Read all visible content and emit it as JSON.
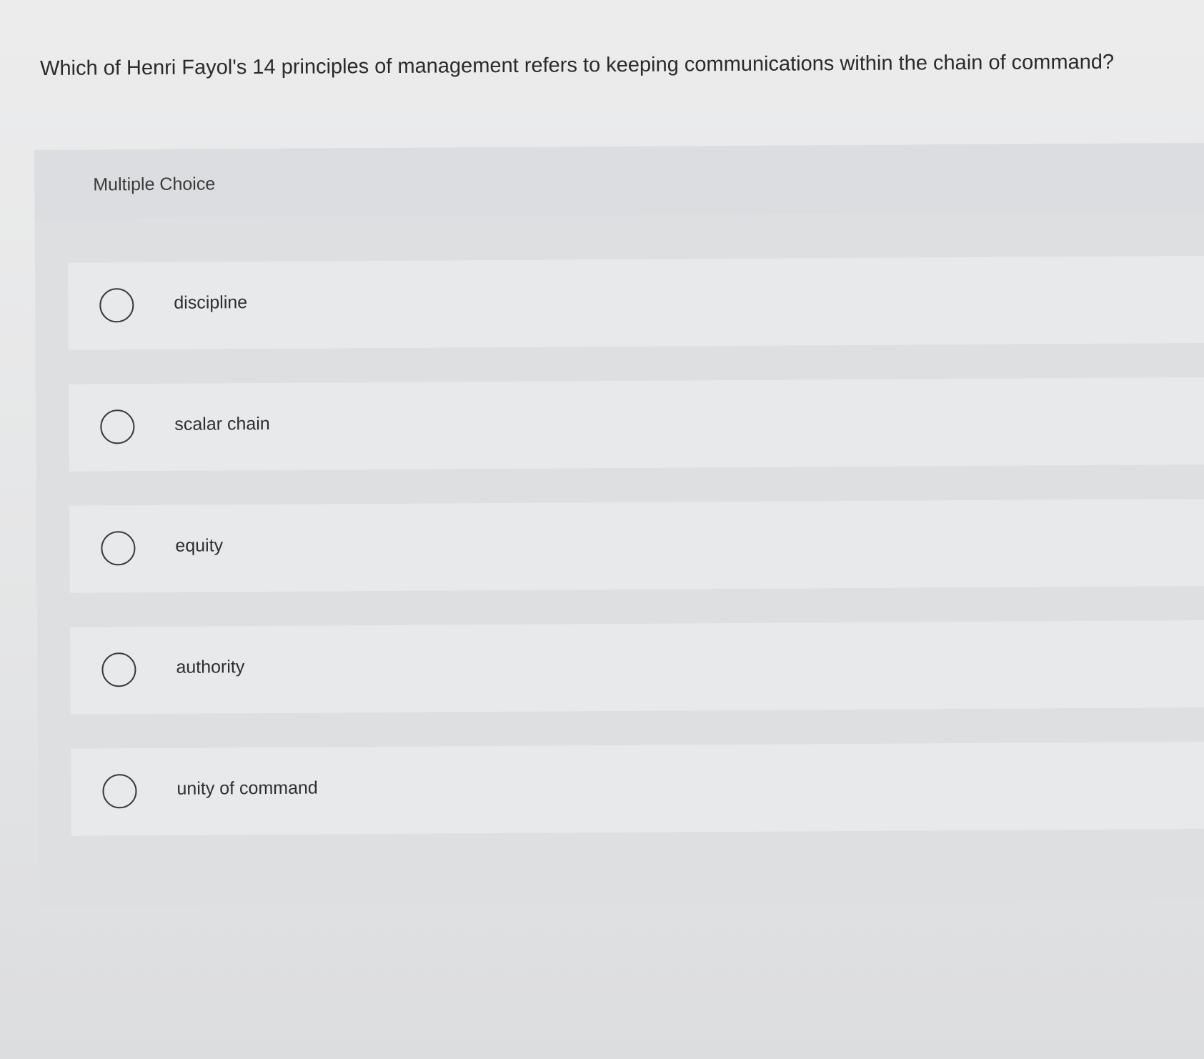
{
  "question": {
    "text": "Which of Henri Fayol's 14 principles of management refers to keeping communications within the chain of command?"
  },
  "multiple_choice": {
    "label": "Multiple Choice",
    "options": [
      {
        "label": "discipline",
        "selected": false
      },
      {
        "label": "scalar chain",
        "selected": false
      },
      {
        "label": "equity",
        "selected": false
      },
      {
        "label": "authority",
        "selected": false
      },
      {
        "label": "unity of command",
        "selected": false
      }
    ]
  }
}
